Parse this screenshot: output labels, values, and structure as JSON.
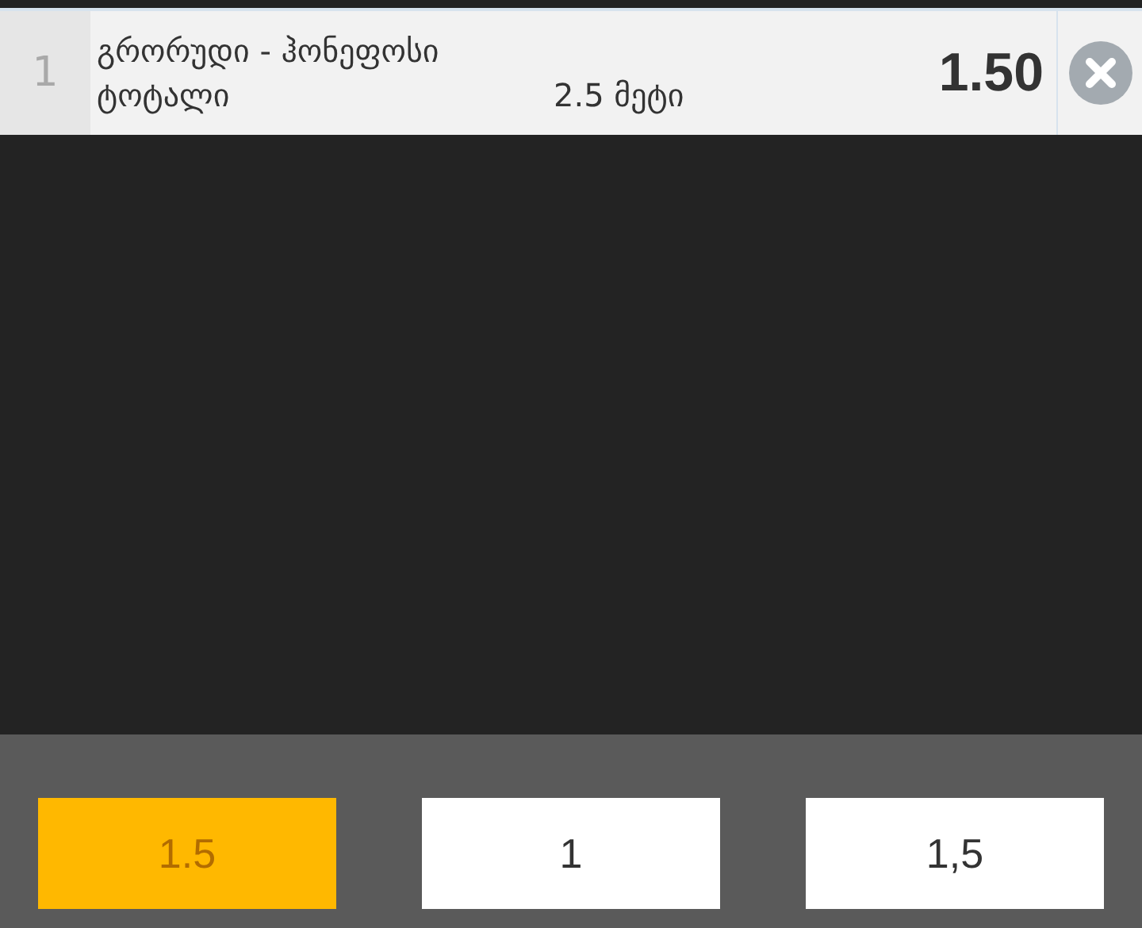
{
  "bet": {
    "index": "1",
    "match": "გრორუდი - ჰონეფოსი",
    "market": "ტოტალი",
    "selection": "2.5 მეტი",
    "odds": "1.50"
  },
  "quick_values": [
    {
      "label": "1.5",
      "selected": true
    },
    {
      "label": "1",
      "selected": false
    },
    {
      "label": "1,5",
      "selected": false
    }
  ]
}
